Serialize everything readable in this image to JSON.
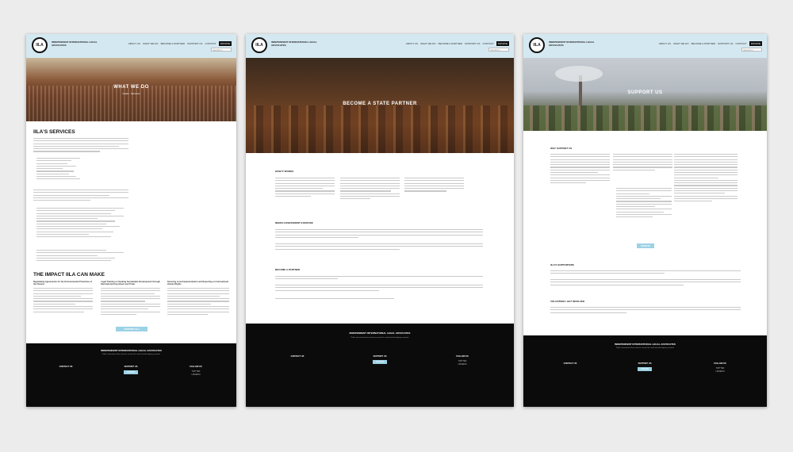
{
  "org_name": "INDEPENDENT INTERNATIONAL LEGAL ADVOCATES",
  "logo_text": "IILA",
  "footer_tagline": "Public international law in-house counsel for small and developing countries",
  "footer_columns": {
    "contact": "CONTACT US",
    "support": "SUPPORT US",
    "follow": "FOLLOW US",
    "donate": "DONATE",
    "twitter": "TWITTER",
    "linkedin": "LINKEDIN"
  },
  "search_placeholder": "SEARCH",
  "pages": [
    {
      "nav": [
        "ABOUT US",
        "WHAT WE DO",
        "BECOME A PARTNER",
        "SUPPORT US",
        "CONTACT"
      ],
      "nav_cta": "DONATE",
      "hero_title": "WHAT WE DO",
      "hero_sub": "Goals · Services",
      "section_title": "IILA'S SERVICES",
      "section2_title": "THE IMPACT IILA CAN MAKE",
      "impact_cols": [
        "Negotiating Agreements for the Environmental Protection of the Oceans",
        "Legal Training on Seeking Sustainable Development through International Investment and Trade",
        "Securing Local Implementation and Reporting on International Human Rights"
      ],
      "button": "SUPPORT IILA"
    },
    {
      "nav": [
        "ABOUT US",
        "WHAT WE DO",
        "BECOME A PARTNER",
        "SUPPORT US",
        "CONTACT"
      ],
      "nav_cta": "DONATE",
      "hero_title": "BECOME A STATE PARTNER",
      "how_title": "HOW IT WORKS",
      "needs_title": "NEEDS ASSESSMENT EXERCISE",
      "partner_title": "BECOME A PARTNER"
    },
    {
      "nav": [
        "ABOUT US",
        "WHAT WE DO",
        "BECOME A PARTNER",
        "SUPPORT US",
        "CONTACT"
      ],
      "nav_cta": "DONATE",
      "hero_title": "SUPPORT US",
      "why_title": "WHY SUPPORT US",
      "supporters_title": "IILA'S SUPPORTERS",
      "volunteer_title": "VOLUNTEER / GET INVOLVED",
      "button": "DONATE"
    }
  ]
}
